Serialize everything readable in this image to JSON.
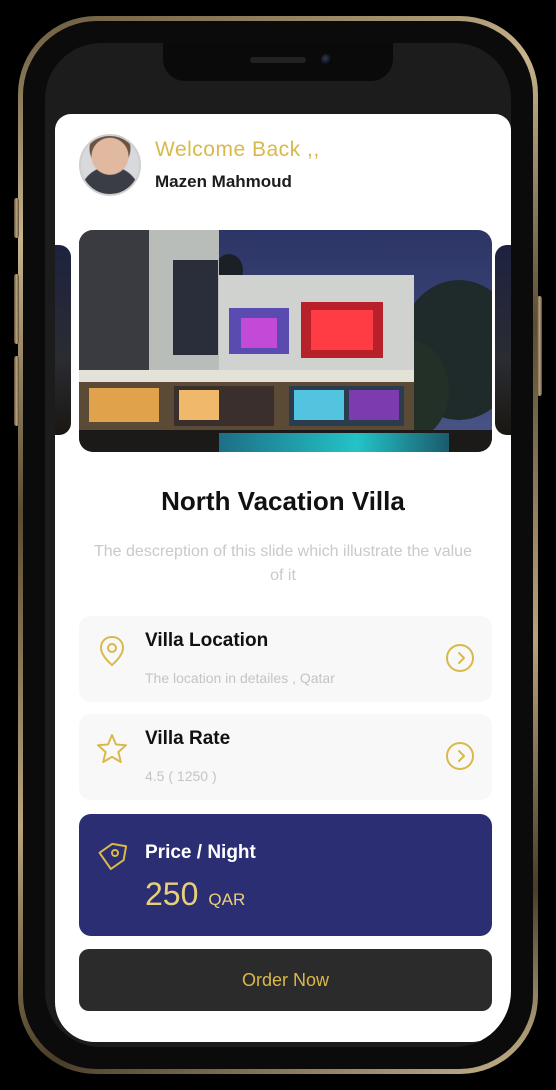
{
  "header": {
    "welcome": "Welcome Back ,,",
    "user_name": "Mazen Mahmoud"
  },
  "villa": {
    "title": "North Vacation Villa",
    "description": "The descreption of this slide which illustrate the value of it"
  },
  "location_card": {
    "title": "Villa Location",
    "detail": "The location in detailes , Qatar",
    "icon": "location-pin-icon"
  },
  "rate_card": {
    "title": "Villa Rate",
    "detail": "4.5  ( 1250 )",
    "icon": "star-icon"
  },
  "price_card": {
    "label": "Price / Night",
    "amount": "250",
    "currency": "QAR",
    "icon": "price-tag-icon"
  },
  "order_button": {
    "label": "Order Now"
  },
  "colors": {
    "accent_gold": "#d9b94a",
    "price_card_bg": "#2b2e72",
    "button_bg": "#2b2b2b"
  }
}
